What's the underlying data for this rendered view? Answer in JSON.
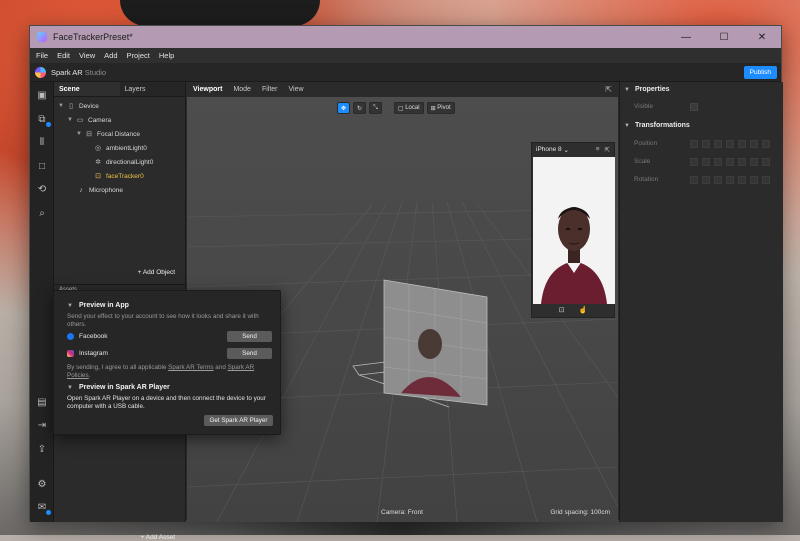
{
  "window": {
    "title": "FaceTrackerPreset*",
    "controls": {
      "minimize": "—",
      "maximize": "☐",
      "close": "✕"
    }
  },
  "menu": [
    "File",
    "Edit",
    "View",
    "Add",
    "Project",
    "Help"
  ],
  "brand": {
    "name": "Spark AR",
    "suffix": "Studio",
    "publish_label": "Publish"
  },
  "scene_panel": {
    "tabs": [
      "Scene",
      "Layers"
    ],
    "tree": [
      {
        "label": "Device",
        "icon": "device-icon"
      },
      {
        "label": "Camera",
        "icon": "camera-icon"
      },
      {
        "label": "Focal Distance",
        "icon": "focal-distance-icon"
      },
      {
        "label": "ambientLight0",
        "icon": "ambient-light-icon"
      },
      {
        "label": "directionalLight0",
        "icon": "directional-light-icon"
      },
      {
        "label": "faceTracker0",
        "icon": "face-tracker-icon",
        "selected": true
      },
      {
        "label": "Microphone",
        "icon": "microphone-icon"
      }
    ],
    "add_object_label": "+ Add Object",
    "assets_label": "Assets",
    "add_asset_label": "+ Add Asset"
  },
  "viewport": {
    "tabs": [
      "Viewport",
      "Mode",
      "Filter",
      "View"
    ],
    "tools": {
      "local_label": "Local",
      "pivot_label": "Pivot"
    },
    "device": "iPhone 8",
    "camera_label": "Camera: Front",
    "grid_label": "Grid spacing: 100cm"
  },
  "properties": {
    "title": "Properties",
    "visible_label": "Visible",
    "transformations_title": "Transformations",
    "rows": [
      "Position",
      "Scale",
      "Rotation"
    ]
  },
  "popup": {
    "preview_app_title": "Preview in App",
    "preview_app_desc": "Send your effect to your account to see how it looks and share it with others.",
    "facebook_label": "Facebook",
    "instagram_label": "Instagram",
    "send_label": "Send",
    "terms_prefix": "By sending, I agree to all applicable ",
    "terms_link": "Spark AR Terms",
    "terms_and": " and ",
    "policies_link": "Spark AR Policies",
    "terms_suffix": ".",
    "preview_player_title": "Preview in Spark AR Player",
    "preview_player_desc": "Open Spark AR Player on a device and then connect the device to your computer with a USB cable.",
    "get_player_label": "Get Spark AR Player"
  },
  "colors": {
    "accent": "#1c8cff",
    "selection": "#f0c348",
    "titlebar": "#b49ab3"
  }
}
